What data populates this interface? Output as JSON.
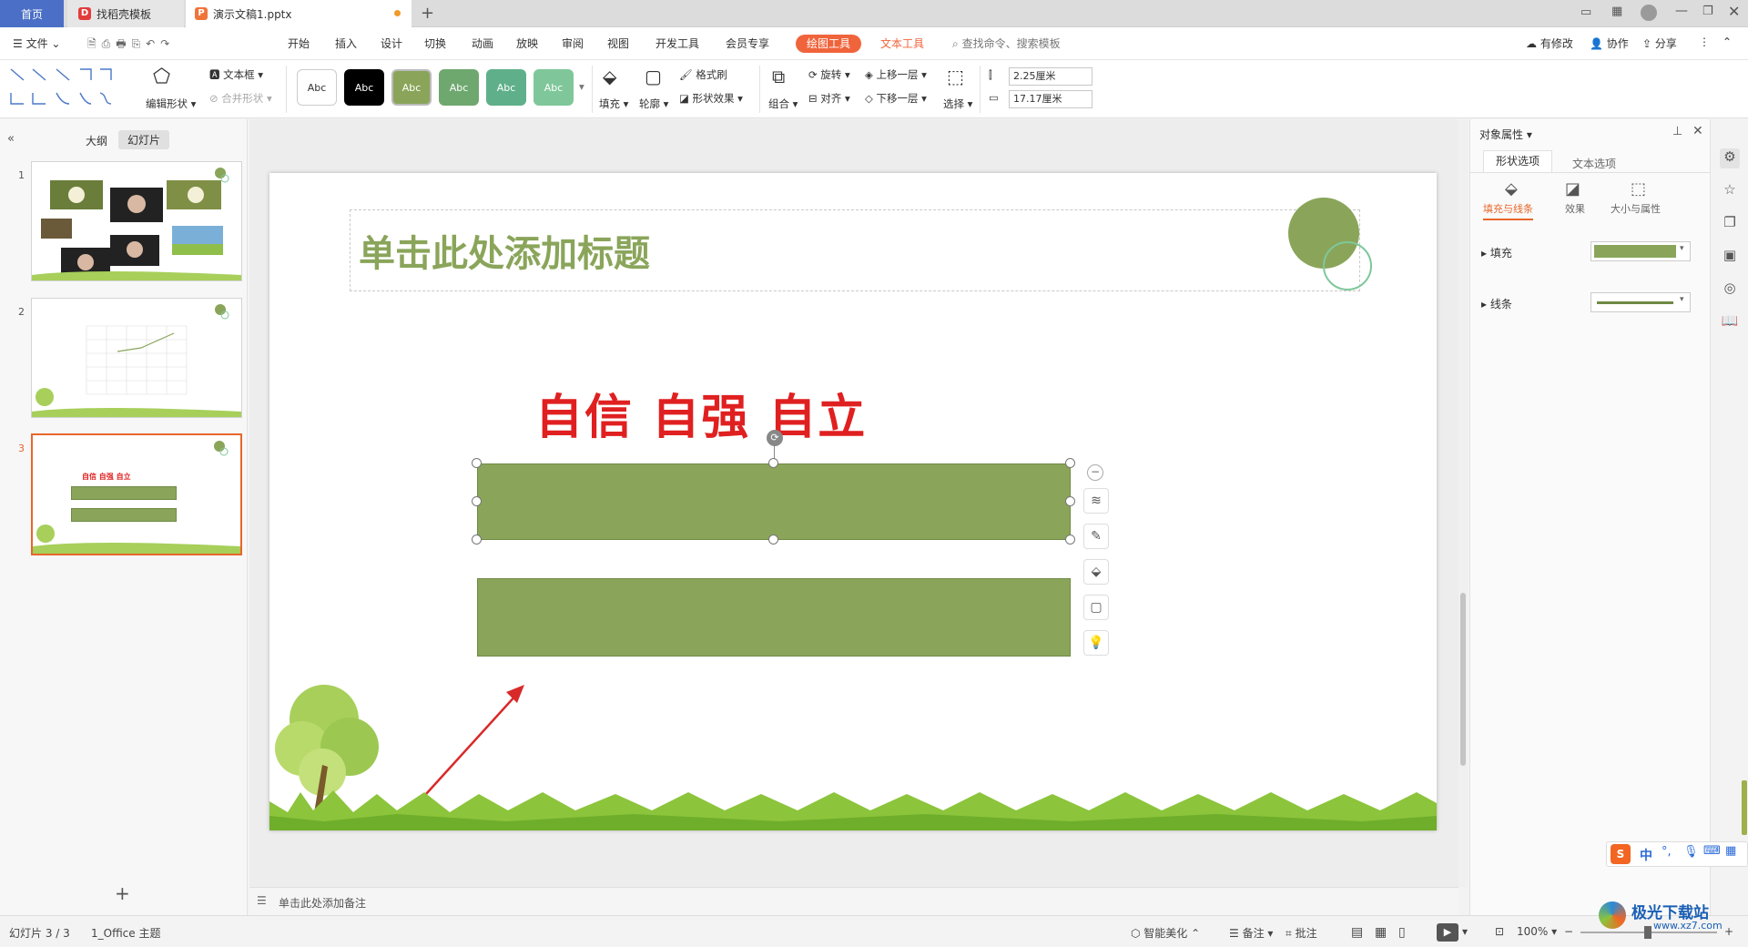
{
  "tabs": {
    "home": "首页",
    "template": "找稻壳模板",
    "document": "演示文稿1.pptx"
  },
  "menu": {
    "file": "文件",
    "items": [
      "开始",
      "插入",
      "设计",
      "切换",
      "动画",
      "放映",
      "审阅",
      "视图",
      "开发工具",
      "会员专享"
    ],
    "drawing_tools": "绘图工具",
    "text_tools": "文本工具",
    "search_placeholder": "查找命令、搜索模板",
    "has_changes": "有修改",
    "collaborate": "协作",
    "share": "分享"
  },
  "ribbon": {
    "edit_shape": "编辑形状",
    "text_box": "文本框",
    "merge_shape": "合并形状",
    "style_label": "Abc",
    "fill": "填充",
    "outline": "轮廓",
    "format_painter": "格式刷",
    "shape_effects": "形状效果",
    "rotate": "旋转",
    "bring_forward": "上移一层",
    "group": "组合",
    "align": "对齐",
    "send_backward": "下移一层",
    "select": "选择",
    "height": "2.25厘米",
    "width": "17.17厘米"
  },
  "left_panel": {
    "outline_tab": "大纲",
    "slides_tab": "幻灯片",
    "slide_numbers": [
      "1",
      "2",
      "3"
    ],
    "thumb3_text": "自信 自强 自立"
  },
  "slide": {
    "title_placeholder": "单击此处添加标题",
    "heading": "自信 自强 自立",
    "shape_color": "#8aa55a",
    "heading_color": "#e02020"
  },
  "notes_placeholder": "单击此处添加备注",
  "right_panel": {
    "title": "对象属性",
    "tab_shape": "形状选项",
    "tab_text": "文本选项",
    "sub_fill_line": "填充与线条",
    "sub_effects": "效果",
    "sub_size": "大小与属性",
    "fill_label": "填充",
    "line_label": "线条",
    "fill_color": "#8aa55a"
  },
  "status": {
    "slide_info": "幻灯片 3 / 3",
    "theme": "1_Office 主题",
    "smart_beautify": "智能美化",
    "notes": "备注",
    "comments": "批注",
    "zoom": "100%"
  },
  "ime": {
    "lang": "中"
  },
  "watermark": "极光下载站",
  "watermark_url": "www.xz7.com"
}
